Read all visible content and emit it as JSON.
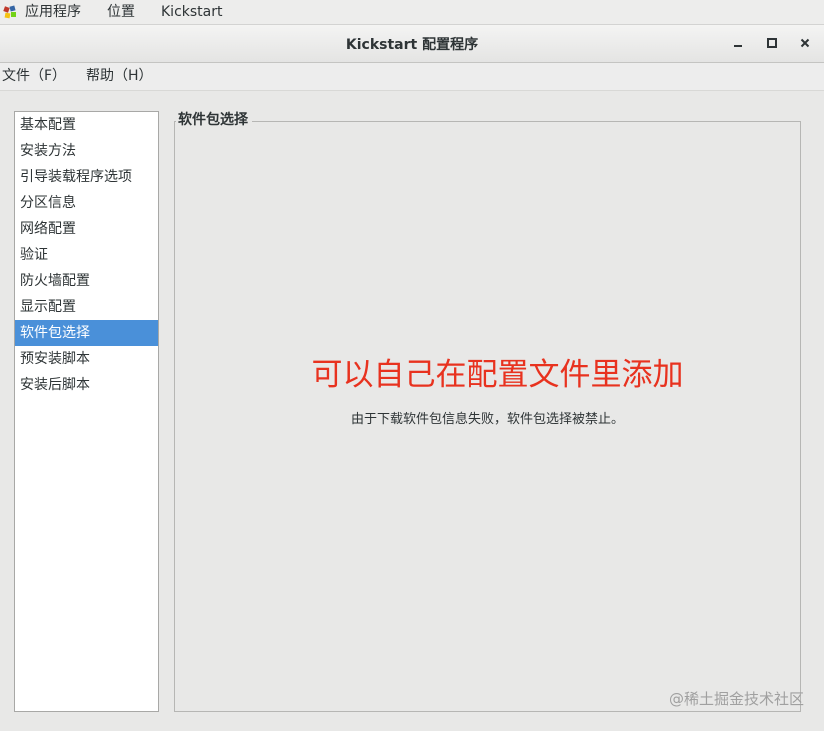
{
  "top_panel": {
    "applications": "应用程序",
    "places": "位置",
    "app_name": "Kickstart"
  },
  "window": {
    "title": "Kickstart 配置程序",
    "minimize_icon": "minimize-icon",
    "maximize_icon": "maximize-icon",
    "close_icon": "close-icon"
  },
  "menubar": {
    "file": "文件（F）",
    "help": "帮助（H）"
  },
  "sidebar": {
    "items": [
      {
        "label": "基本配置"
      },
      {
        "label": "安装方法"
      },
      {
        "label": "引导装载程序选项"
      },
      {
        "label": "分区信息"
      },
      {
        "label": "网络配置"
      },
      {
        "label": "验证"
      },
      {
        "label": "防火墙配置"
      },
      {
        "label": "显示配置"
      },
      {
        "label": "软件包选择"
      },
      {
        "label": "预安装脚本"
      },
      {
        "label": "安装后脚本"
      }
    ],
    "selected": "软件包选择"
  },
  "pane": {
    "title": "软件包选择",
    "annotation": "可以自己在配置文件里添加",
    "message": "由于下载软件包信息失败，软件包选择被禁止。"
  },
  "watermark": "@稀土掘金技术社区",
  "colors": {
    "selection": "#4a90d9",
    "annotation": "#e8321f"
  }
}
